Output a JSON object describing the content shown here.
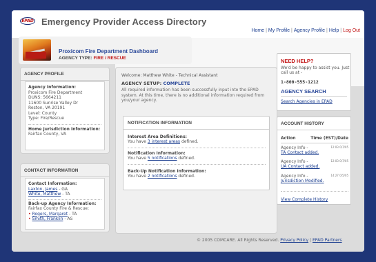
{
  "header": {
    "logo_text": "EPAD",
    "site_title": "Emergency Provider Access Directory",
    "nav": [
      "Home",
      "My Profile",
      "Agency Profile",
      "Help",
      "Log Out"
    ]
  },
  "dashboard": {
    "title": "Proxicom Fire Department Dashboard",
    "agency_type_label": "AGENCY TYPE:",
    "agency_type_value": "FIRE / RESCUE"
  },
  "agency_profile": {
    "heading": "AGENCY PROFILE",
    "info_label": "Agency Information:",
    "info_lines": [
      "Proxicom Fire Department",
      "DUNS: 5664211",
      "11600 Sunrise Valley Dr",
      "Reston, VA 20191",
      "Level: County",
      "Type: Fire/Rescue"
    ],
    "home_label": "Home Jurisdiction Information:",
    "home_value": "Fairfax County, VA"
  },
  "contact_info": {
    "heading": "CONTACT INFORMATION",
    "contact_label": "Contact Information:",
    "contacts": [
      {
        "name": "Laxton, James",
        "role": " - GA"
      },
      {
        "name": "White, Matthew",
        "role": " - TA"
      }
    ],
    "backup_label": "Back-up Agency Information:",
    "backup_agency": "Fairfax County Fire & Rescue:",
    "backups": [
      {
        "name": "Rogers, Margaret",
        "role": " - TA"
      },
      {
        "name": "Smith, Franklin",
        "role": " - AS"
      }
    ]
  },
  "main": {
    "welcome": "Welcome: Matthew White - Technical Assistant",
    "setup_label": "AGENCY SETUP:",
    "setup_status": "COMPLETE",
    "setup_message": "All required information has been successfully input into the EPAD system. At this time, there is no additional information required from you/your agency."
  },
  "notifications": {
    "heading": "NOTIFICATION INFORMATION",
    "items": [
      {
        "title": "Interest Area Definitions:",
        "pre": "You have ",
        "link": "3 interest areas",
        "post": " defined."
      },
      {
        "title": "Notification Information:",
        "pre": "You have ",
        "link": "5 notifications",
        "post": " defined."
      },
      {
        "title": "Back-Up Notification Information:",
        "pre": "You have ",
        "link": "2 notifications",
        "post": " defined."
      }
    ]
  },
  "help": {
    "title": "NEED HELP?",
    "body": "We'd be happy to assist you. Just call us at -",
    "phone": "1-800-555-1212",
    "search_title": "AGENCY SEARCH",
    "search_link": "Search Agencies in EPAD"
  },
  "history": {
    "heading": "ACCOUNT HISTORY",
    "col_action": "Action",
    "col_time": "Time (EST)/Date",
    "rows": [
      {
        "pre": "Agency Info -",
        "link": "TA Contact added.",
        "time": "12:03 0/7/05"
      },
      {
        "pre": "Agency Info -",
        "link": "UA Contact added.",
        "time": "12:03 0/7/05"
      },
      {
        "pre": "Agency Info -",
        "link": "Jurisdiction Modified.",
        "time": "14:27 0/5/05"
      }
    ],
    "view_all": "View Complete History"
  },
  "footer": {
    "copyright": "© 2005 COMCARE. All Rights Reserved.",
    "links": [
      "Privacy Policy",
      "EPAD Partners"
    ]
  },
  "colors": {
    "background": "#1f3577",
    "accent_red": "#c01010",
    "accent_blue": "#2c4a9a"
  }
}
